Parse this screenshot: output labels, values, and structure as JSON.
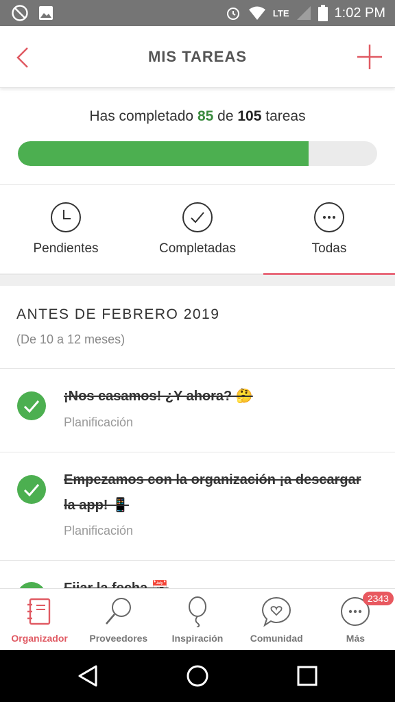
{
  "status_bar": {
    "time": "1:02 PM",
    "network": "LTE"
  },
  "header": {
    "title": "MIS TAREAS"
  },
  "progress": {
    "prefix": "Has completado",
    "completed": "85",
    "middle": "de",
    "total": "105",
    "suffix": "tareas",
    "fraction": 0.81
  },
  "tabs": [
    {
      "label": "Pendientes",
      "icon": "clock-icon"
    },
    {
      "label": "Completadas",
      "icon": "check-circle-icon"
    },
    {
      "label": "Todas",
      "icon": "more-circle-icon"
    }
  ],
  "section": {
    "title": "ANTES DE FEBRERO 2019",
    "subtitle": "(De 10 a 12 meses)"
  },
  "tasks": [
    {
      "title": "¡Nos casamos! ¿Y ahora? 🤔",
      "category": "Planificación"
    },
    {
      "title": "Empezamos con la organización ¡a descargar la app! 📱",
      "category": "Planificación"
    },
    {
      "title": "Fijar la fecha 📅",
      "category": ""
    }
  ],
  "bottom_nav": [
    {
      "label": "Organizador",
      "icon": "planner-icon"
    },
    {
      "label": "Proveedores",
      "icon": "magnifier-icon"
    },
    {
      "label": "Inspiración",
      "icon": "balloon-icon"
    },
    {
      "label": "Comunidad",
      "icon": "chat-heart-icon"
    },
    {
      "label": "Más",
      "icon": "more-icon",
      "badge": "2343"
    }
  ],
  "colors": {
    "accent": "#e05a63",
    "progress": "#4caf50",
    "status_bar": "#757575"
  }
}
